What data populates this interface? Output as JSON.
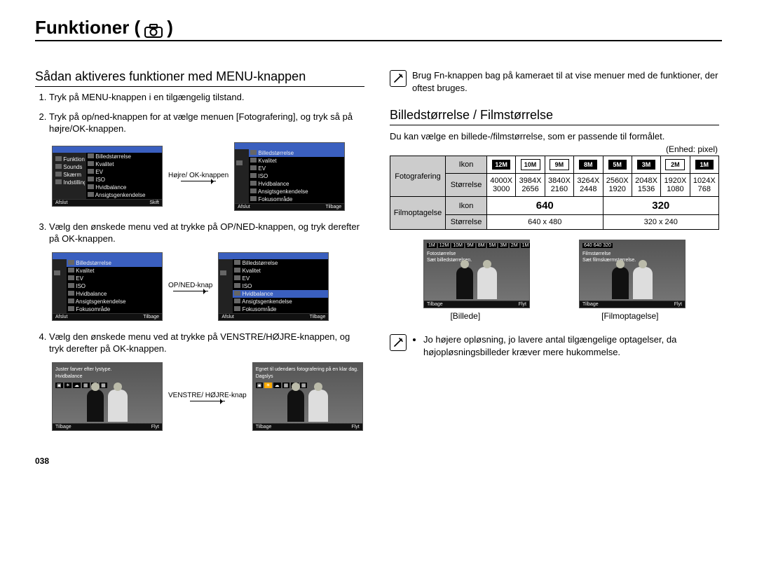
{
  "title": "Funktioner (",
  "title_close": ")",
  "page_number": "038",
  "left": {
    "heading": "Sådan aktiveres funktioner med MENU-knappen",
    "steps": [
      "Tryk på MENU-knappen i en tilgængelig tilstand.",
      "Tryk på op/ned-knappen for at vælge menuen [Fotografering], og tryk så på højre/OK-knappen.",
      "Vælg den ønskede menu ved at trykke på OP/NED-knappen, og tryk derefter på OK-knappen.",
      "Vælg den ønskede menu ved at trykke på VENSTRE/HØJRE-knappen, og tryk derefter på OK-knappen."
    ],
    "arrow1": "Højre/ OK-knappen",
    "arrow2": "OP/NED-knap",
    "arrow3": "VENSTRE/ HØJRE-knap",
    "menu_side": [
      "Funktioner",
      "Sounds",
      "Skærm",
      "Indstillinger"
    ],
    "menu_items": [
      "Billedstørrelse",
      "Kvalitet",
      "EV",
      "ISO",
      "Hvidbalance",
      "Ansigtsgenkendelse",
      "Fokusområde"
    ],
    "foot_afslut": "Afslut",
    "foot_skift": "Skift",
    "foot_tilbage": "Tilbage",
    "foot_flyt": "Flyt",
    "photo_label1": "Juster farver efter lystype.",
    "photo_label2": "Hvidbalance",
    "photo_label3": "Egnet til udendørs fotografering på en klar dag.",
    "photo_label4": "Dagslys"
  },
  "right": {
    "note": "Brug Fn-knappen bag på kameraet til at vise menuer med de funktioner, der oftest bruges.",
    "heading": "Billedstørrelse / Filmstørrelse",
    "intro": "Du kan vælge en billede-/filmstørrelse, som er passende til formålet.",
    "unit": "(Enhed: pixel)",
    "row_photo": "Fotografering",
    "row_movie": "Filmoptagelse",
    "col_icon": "Ikon",
    "col_size": "Størrelse",
    "icons": [
      "12M",
      "10M",
      "9M",
      "8M",
      "5M",
      "3M",
      "2M",
      "1M"
    ],
    "sizes_w": [
      "4000X",
      "3984X",
      "3840X",
      "3264X",
      "2560X",
      "2048X",
      "1920X",
      "1024X"
    ],
    "sizes_h": [
      "3000",
      "2656",
      "2160",
      "2448",
      "1920",
      "1536",
      "1080",
      "768"
    ],
    "movie_icons": [
      "640",
      "320"
    ],
    "movie_sizes": [
      "640 x 480",
      "320 x 240"
    ],
    "cap_photo": "[Billede]",
    "cap_movie": "[Filmoptagelse]",
    "mini_photo_label1": "Fotostørrelse",
    "mini_photo_label2": "Sæt billedstørrelsen.",
    "mini_movie_label1": "Filmstørrelse",
    "mini_movie_label2": "Sæt filmskærmstørrelse.",
    "mini_movie_icons": "640 640 320",
    "note2": "Jo højere opløsning, jo lavere antal tilgængelige optagelser, da højopløsningsbilleder kræver mere hukommelse."
  }
}
